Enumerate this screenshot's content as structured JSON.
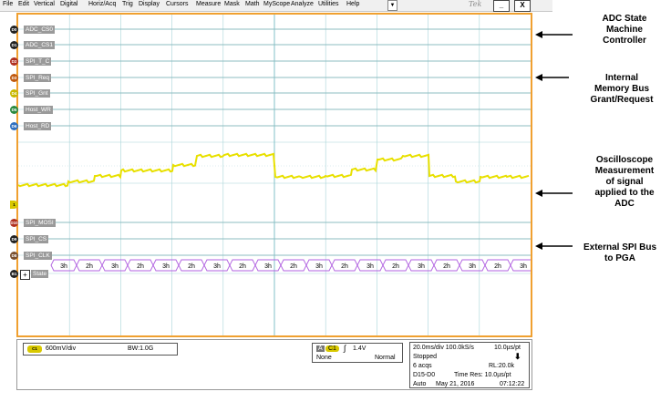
{
  "menu": [
    "File",
    "Edit",
    "Vertical",
    "Digital",
    "Horiz/Acq",
    "Trig",
    "Display",
    "Cursors",
    "Measure",
    "Mask",
    "Math",
    "MyScope",
    "Analyze",
    "Utilities",
    "Help"
  ],
  "menu_arrow": "▼",
  "brand": "Tek",
  "window_buttons": {
    "minimize": "_",
    "close": "X"
  },
  "channels": [
    {
      "badge": "D0",
      "label": "ADC_CS0",
      "color": "#222222"
    },
    {
      "badge": "D1",
      "label": "ADC_CS1",
      "color": "#222222"
    },
    {
      "badge": "D2",
      "label": "SPI_T_C",
      "color": "#b03020"
    },
    {
      "badge": "D3",
      "label": "SPI_Req",
      "color": "#c05a10"
    },
    {
      "badge": "D4",
      "label": "SPI_Gnt",
      "color": "#c8b800"
    },
    {
      "badge": "D5",
      "label": "Host_WR",
      "color": "#2a8a40"
    },
    {
      "badge": "D6",
      "label": "Host_RD",
      "color": "#3070c0"
    },
    {
      "badge": "1",
      "label": "",
      "color": "#d8c800"
    },
    {
      "badge": "D10",
      "label": "SPI_MOSI",
      "color": "#b03020"
    },
    {
      "badge": "D9",
      "label": "SPI_CS",
      "color": "#222222"
    },
    {
      "badge": "D8",
      "label": "SPI_CLK",
      "color": "#7a5030"
    },
    {
      "badge": "B1",
      "label": "State",
      "color": "#222222"
    }
  ],
  "bus": {
    "expand_symbol": "+",
    "values": [
      "3h",
      "2h",
      "3h",
      "2h",
      "3h",
      "2h",
      "3h",
      "2h",
      "3h",
      "2h",
      "3h",
      "2h",
      "3h",
      "2h",
      "3h",
      "2h",
      "3h",
      "2h",
      "3h",
      "2h"
    ]
  },
  "annotations": [
    {
      "lines": [
        "ADC State",
        "Machine",
        "Controller"
      ]
    },
    {
      "lines": [
        "Internal",
        "Memory Bus",
        "Grant/Request"
      ]
    },
    {
      "lines": [
        "Oscilloscope",
        "Measurement",
        "of signal",
        "applied to the",
        "ADC"
      ]
    },
    {
      "lines": [
        "External SPI Bus",
        "to PGA"
      ]
    }
  ],
  "status": {
    "ch1_badge": "C1",
    "ch1_scale": "600mV/div",
    "bandwidth": "BW:1.0G",
    "trig_source": "A",
    "trig_ch": "C1",
    "trig_level": "1.4V",
    "trig_coupling": "None",
    "trig_mode": "Normal",
    "horiz": "20.0ms/div 100.0kS/s",
    "sample_interval": "10.0µs/pt",
    "acq_state": "Stopped",
    "acqs": "6 acqs",
    "record_length": "RL:20.0k",
    "digital_range": "D15-D0",
    "time_res": "Time Res: 10.0µs/pt",
    "trig_type": "Auto",
    "date": "May 21, 2016",
    "time": "07:12:22"
  },
  "colors": {
    "frame": "#f0a030",
    "grid": "#a8d4d8",
    "analog": "#e8e000",
    "bus": "#b060e0"
  }
}
